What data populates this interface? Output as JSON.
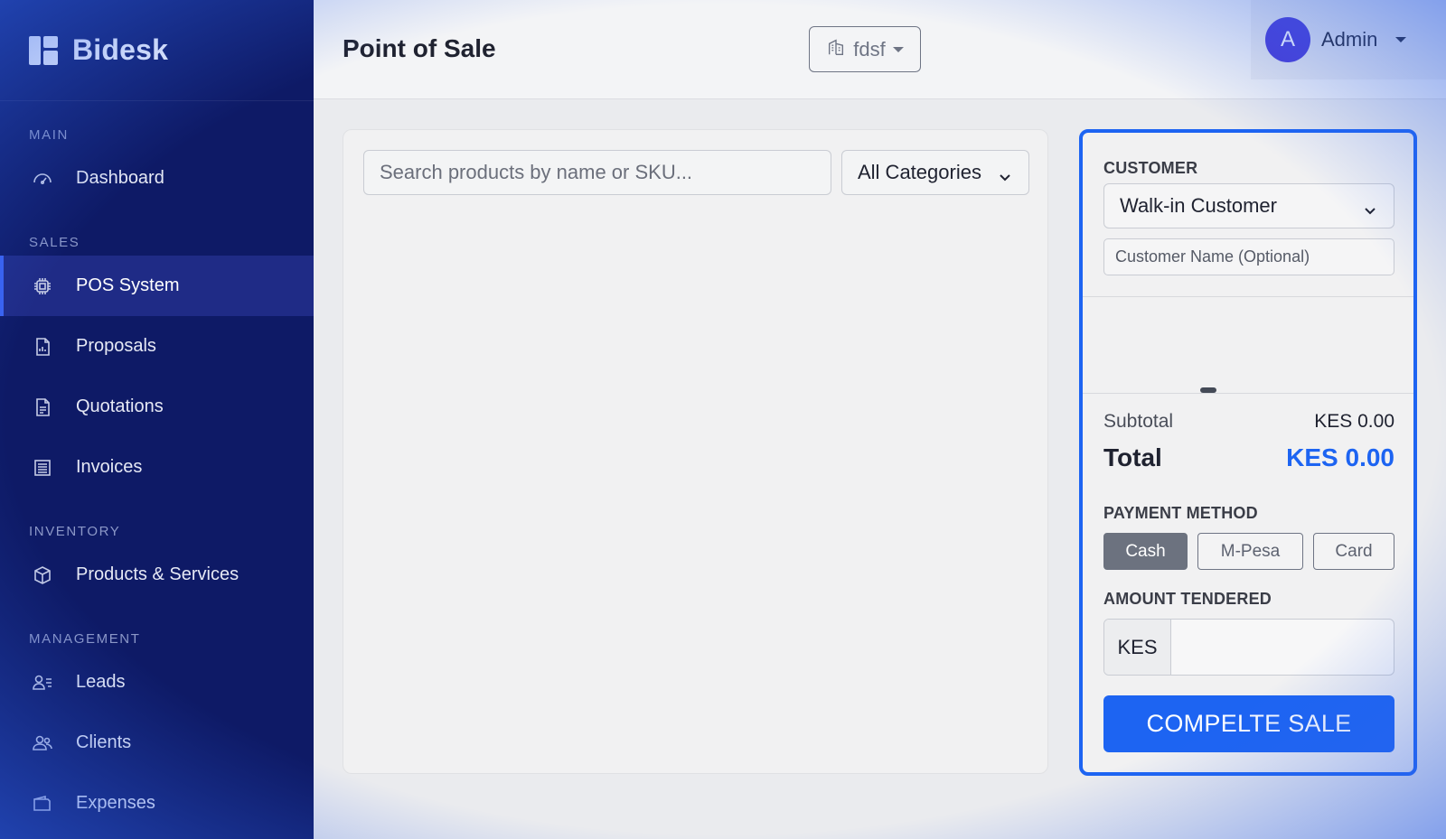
{
  "app": {
    "name": "Bidesk"
  },
  "sidebar": {
    "sections": [
      {
        "label": "MAIN",
        "items": [
          {
            "label": "Dashboard",
            "icon": "gauge-icon"
          }
        ]
      },
      {
        "label": "SALES",
        "items": [
          {
            "label": "POS System",
            "icon": "chip-icon",
            "active": true
          },
          {
            "label": "Proposals",
            "icon": "document-chart-icon"
          },
          {
            "label": "Quotations",
            "icon": "document-icon"
          },
          {
            "label": "Invoices",
            "icon": "receipt-icon"
          }
        ]
      },
      {
        "label": "INVENTORY",
        "items": [
          {
            "label": "Products & Services",
            "icon": "box-icon"
          }
        ]
      },
      {
        "label": "MANAGEMENT",
        "items": [
          {
            "label": "Leads",
            "icon": "person-lines-icon"
          },
          {
            "label": "Clients",
            "icon": "people-icon"
          },
          {
            "label": "Expenses",
            "icon": "wallet-icon"
          }
        ]
      }
    ]
  },
  "header": {
    "title": "Point of Sale",
    "branch": "fdsf",
    "user": {
      "initial": "A",
      "name": "Admin"
    }
  },
  "products": {
    "search_placeholder": "Search products by name or SKU...",
    "category": "All Categories"
  },
  "cart": {
    "customer_label": "CUSTOMER",
    "customer_selected": "Walk-in Customer",
    "customer_name_placeholder": "Customer Name (Optional)",
    "subtotal_label": "Subtotal",
    "subtotal_value": "KES 0.00",
    "total_label": "Total",
    "total_value": "KES 0.00",
    "payment_label": "PAYMENT METHOD",
    "payment_methods": [
      "Cash",
      "M-Pesa",
      "Card"
    ],
    "payment_selected": "Cash",
    "tendered_label": "AMOUNT TENDERED",
    "currency": "KES",
    "tendered_value": "",
    "complete_label": "COMPELTE SALE"
  },
  "colors": {
    "accent": "#1d64f2",
    "sidebar_bg": "#0e1a66",
    "avatar": "#4a3cd6"
  }
}
